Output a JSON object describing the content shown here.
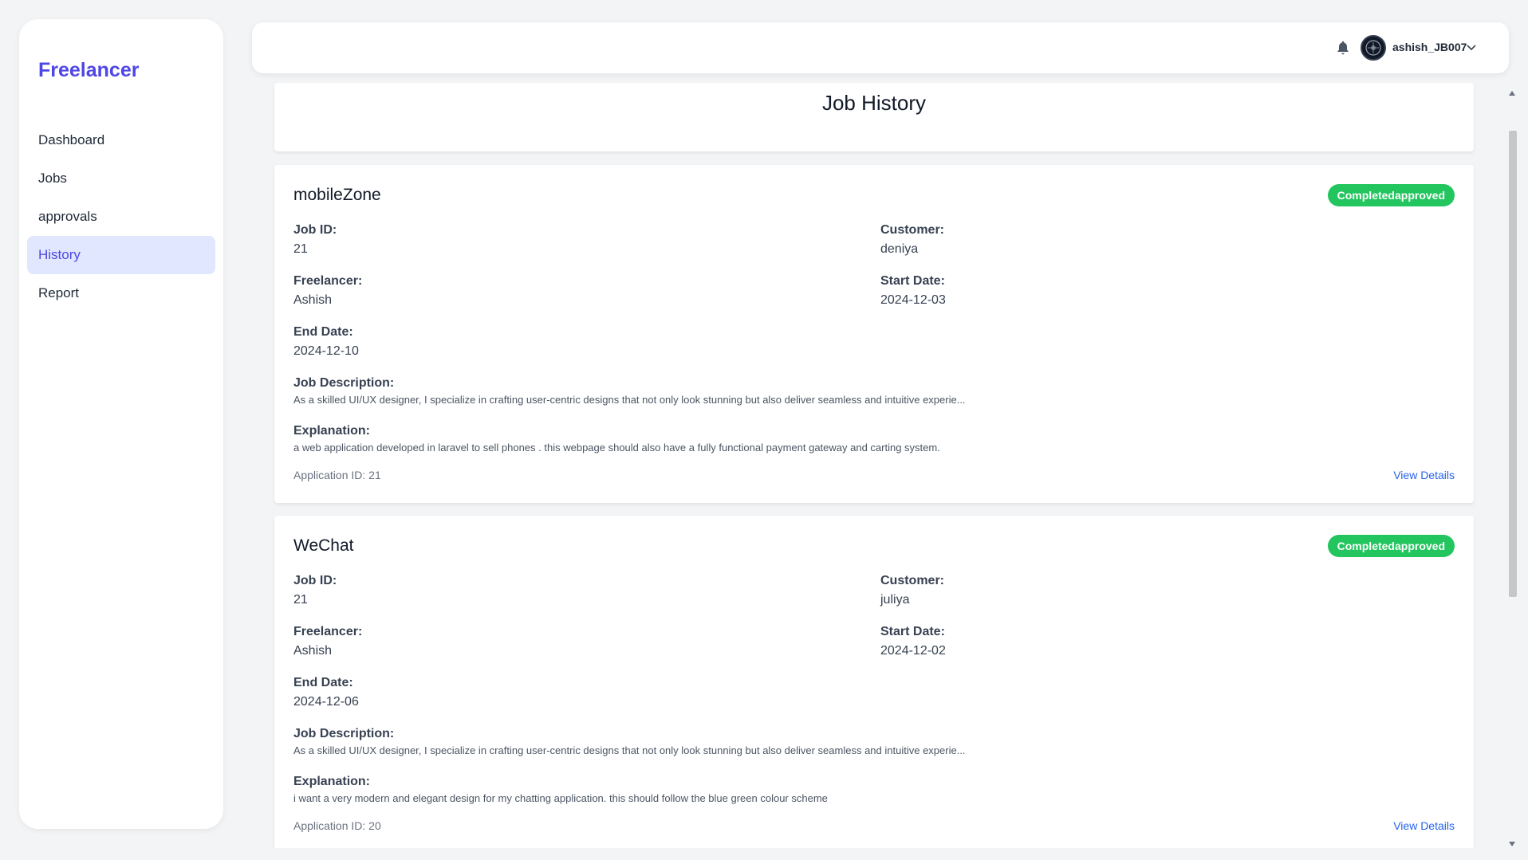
{
  "app": {
    "brand": "Freelancer"
  },
  "sidebar": {
    "items": [
      {
        "label": "Dashboard",
        "active": false
      },
      {
        "label": "Jobs",
        "active": false
      },
      {
        "label": "approvals",
        "active": false
      },
      {
        "label": "History",
        "active": true
      },
      {
        "label": "Report",
        "active": false
      }
    ]
  },
  "header": {
    "user_name": "ashish_JB007",
    "icons": {
      "bell": "bell-icon",
      "avatar": "avatar",
      "dropdown": "chevron-down-icon"
    }
  },
  "page": {
    "title": "Job History"
  },
  "labels": {
    "job_id": "Job ID:",
    "customer": "Customer:",
    "freelancer": "Freelancer:",
    "start_date": "Start Date:",
    "end_date": "End Date:",
    "job_description": "Job Description:",
    "explanation": "Explanation:",
    "view_details": "View Details"
  },
  "jobs": [
    {
      "title": "mobileZone",
      "status": "Completedapproved",
      "job_id": "21",
      "customer": "deniya",
      "freelancer": "Ashish",
      "start_date": "2024-12-03",
      "end_date": "2024-12-10",
      "description": "As a skilled UI/UX designer, I specialize in crafting user-centric designs that not only look stunning but also deliver seamless and intuitive experie...",
      "explanation": "a web application developed in laravel to sell phones . this webpage should also have a fully functional payment gateway and carting system.",
      "application_id": "Application ID: 21"
    },
    {
      "title": "WeChat",
      "status": "Completedapproved",
      "job_id": "21",
      "customer": "juliya",
      "freelancer": "Ashish",
      "start_date": "2024-12-02",
      "end_date": "2024-12-06",
      "description": "As a skilled UI/UX designer, I specialize in crafting user-centric designs that not only look stunning but also deliver seamless and intuitive experie...",
      "explanation": "i want a very modern and elegant design for my chatting application. this should follow the blue green colour scheme",
      "application_id": "Application ID: 20"
    }
  ],
  "colors": {
    "brand": "#4f46e5",
    "active_nav_bg": "#e0e7ff",
    "status_green": "#22c55e",
    "link_blue": "#2563eb"
  }
}
